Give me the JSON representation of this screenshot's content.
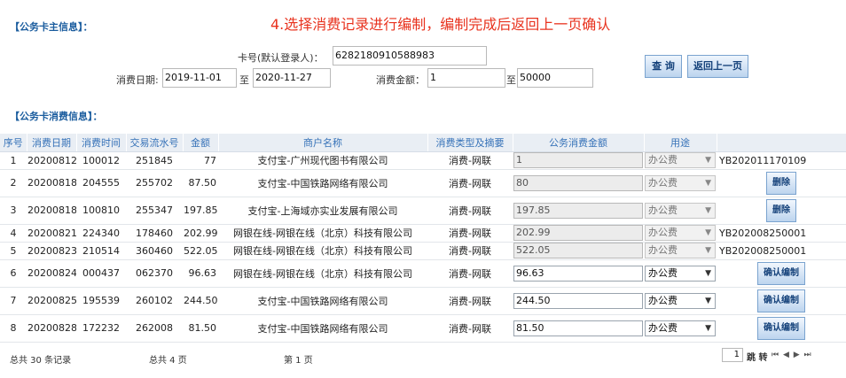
{
  "holder_section_title": "【公务卡主信息】：",
  "banner": "4.选择消费记录进行编制，编制完成后返回上一页确认",
  "search": {
    "card_label": "卡号(默认登录人)：",
    "card_value": "6282180910588983",
    "date_label": "消费日期:",
    "date_from": "2019-11-01",
    "date_to_label": "至",
    "date_to": "2020-11-27",
    "amount_label": "消费金额：",
    "amount_from": "1",
    "amount_to_label": "至",
    "amount_to": "50000",
    "query_button": "查 询",
    "back_button": "返回上一页"
  },
  "records_section_title": "【公务卡消费信息】：",
  "table": {
    "headers": [
      "序号",
      "消费日期",
      "消费时间",
      "交易流水号",
      "金额",
      "商户名称",
      "消费类型及摘要",
      "公务消费金额",
      "用途",
      ""
    ],
    "rows": [
      {
        "no": "1",
        "date": "20200812",
        "time": "100012",
        "serial": "251845",
        "amount": "77",
        "merchant": "支付宝-广州现代图书有限公司",
        "type": "消费-网联",
        "official_amount": "1",
        "purpose": "办公费",
        "action": "YB202011170109",
        "editable": false
      },
      {
        "no": "2",
        "date": "20200818",
        "time": "204555",
        "serial": "255702",
        "amount": "87.50",
        "merchant": "支付宝-中国铁路网络有限公司",
        "type": "消费-网联",
        "official_amount": "80",
        "purpose": "办公费",
        "action": "删除",
        "editable": false
      },
      {
        "no": "3",
        "date": "20200818",
        "time": "100810",
        "serial": "255347",
        "amount": "197.85",
        "merchant": "支付宝-上海域亦实业发展有限公司",
        "type": "消费-网联",
        "official_amount": "197.85",
        "purpose": "办公费",
        "action": "删除",
        "editable": false
      },
      {
        "no": "4",
        "date": "20200821",
        "time": "224340",
        "serial": "178460",
        "amount": "202.99",
        "merchant": "网银在线-网银在线（北京）科技有限公司",
        "type": "消费-网联",
        "official_amount": "202.99",
        "purpose": "办公费",
        "action": "YB202008250001",
        "editable": false
      },
      {
        "no": "5",
        "date": "20200823",
        "time": "210514",
        "serial": "360460",
        "amount": "522.05",
        "merchant": "网银在线-网银在线（北京）科技有限公司",
        "type": "消费-网联",
        "official_amount": "522.05",
        "purpose": "办公费",
        "action": "YB202008250001",
        "editable": false
      },
      {
        "no": "6",
        "date": "20200824",
        "time": "000437",
        "serial": "062370",
        "amount": "96.63",
        "merchant": "网银在线-网银在线（北京）科技有限公司",
        "type": "消费-网联",
        "official_amount": "96.63",
        "purpose": "办公费",
        "action": "确认编制",
        "editable": true
      },
      {
        "no": "7",
        "date": "20200825",
        "time": "195539",
        "serial": "260102",
        "amount": "244.50",
        "merchant": "支付宝-中国铁路网络有限公司",
        "type": "消费-网联",
        "official_amount": "244.50",
        "purpose": "办公费",
        "action": "确认编制",
        "editable": true
      },
      {
        "no": "8",
        "date": "20200828",
        "time": "172232",
        "serial": "262008",
        "amount": "81.50",
        "merchant": "支付宝-中国铁路网络有限公司",
        "type": "消费-网联",
        "official_amount": "81.50",
        "purpose": "办公费",
        "action": "确认编制",
        "editable": true
      }
    ]
  },
  "footer": {
    "total_records": "总共 30 条记录",
    "total_pages": "总共 4 页",
    "current_page": "第 1 页",
    "page_input": "1",
    "jump_label": "跳 转",
    "nav_icons": "⏮ ◀ ▶ ⏭"
  },
  "colors": {
    "banner": "#e8321e",
    "section_title": "#1a5c9e",
    "header_text": "#3672b8",
    "header_bg": "#e9eef4"
  }
}
